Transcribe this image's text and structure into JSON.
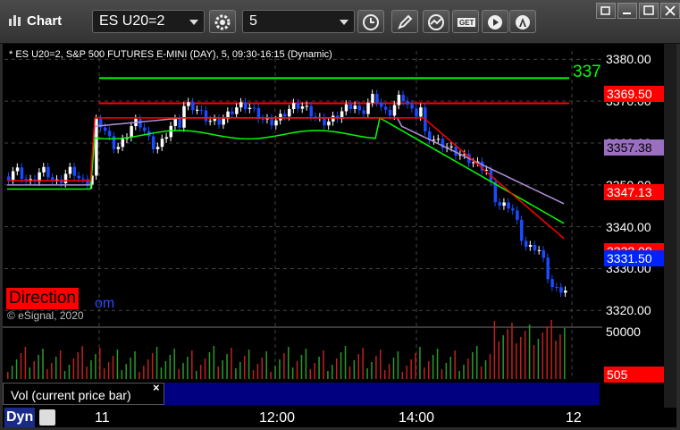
{
  "window": {
    "title": "Chart",
    "symbol_value": "ES U20=2",
    "interval_value": "5",
    "toolbar_icons": [
      "gear-icon",
      "clock-icon",
      "pencil-icon",
      "study-icon",
      "get-icon",
      "play-icon",
      "alert-icon"
    ],
    "window_icons": [
      "restore-icon",
      "minimize-icon",
      "maximize-icon",
      "close-icon"
    ]
  },
  "chart_header": "* ES U20=2, S&P 500 FUTURES E-MINI (DAY), 5, 09:30-16:15 (Dynamic)",
  "watermark": "© eSignal, 2020",
  "direction_label": "Direction",
  "direction_tail": "om",
  "volume_panel": {
    "label": "Vol (current price bar)",
    "close_icon": "×",
    "ticks": [
      "50000"
    ],
    "current": "505"
  },
  "bottom_bar": {
    "dyn_label": "Dyn",
    "x_labels": [
      "11",
      "12:00",
      "14:00",
      "12"
    ]
  },
  "price_axis": {
    "ticks": [
      "3380.00",
      "3370.00",
      "3360.00",
      "3350.00",
      "3340.00",
      "3330.00",
      "3320.00"
    ],
    "markers": [
      {
        "text": "3369.50",
        "bg": "#ff0000",
        "fg": "#ffffff"
      },
      {
        "text": "3357.38",
        "bg": "#9a6fc0",
        "fg": "#000000"
      },
      {
        "text": "3347.13",
        "bg": "#ff0000",
        "fg": "#ffffff"
      },
      {
        "text": "3332.00",
        "bg": "#ff0000",
        "fg": "#ffffff"
      },
      {
        "text": "3331.50",
        "bg": "#0022ff",
        "fg": "#ffffff"
      }
    ],
    "green_line_label": "337"
  },
  "chart_data": {
    "type": "candlestick",
    "ylim": [
      3316,
      3382
    ],
    "colors": {
      "up": "#ffffff",
      "down": "#1a4bff",
      "ema_fast": "#00ff00",
      "ema_slow": "#ff0000",
      "vwap": "#b090d8"
    },
    "horizontal_lines": [
      {
        "value": 3375.5,
        "color": "#00ff00"
      },
      {
        "value": 3369.5,
        "color": "#ff0000"
      }
    ]
  }
}
